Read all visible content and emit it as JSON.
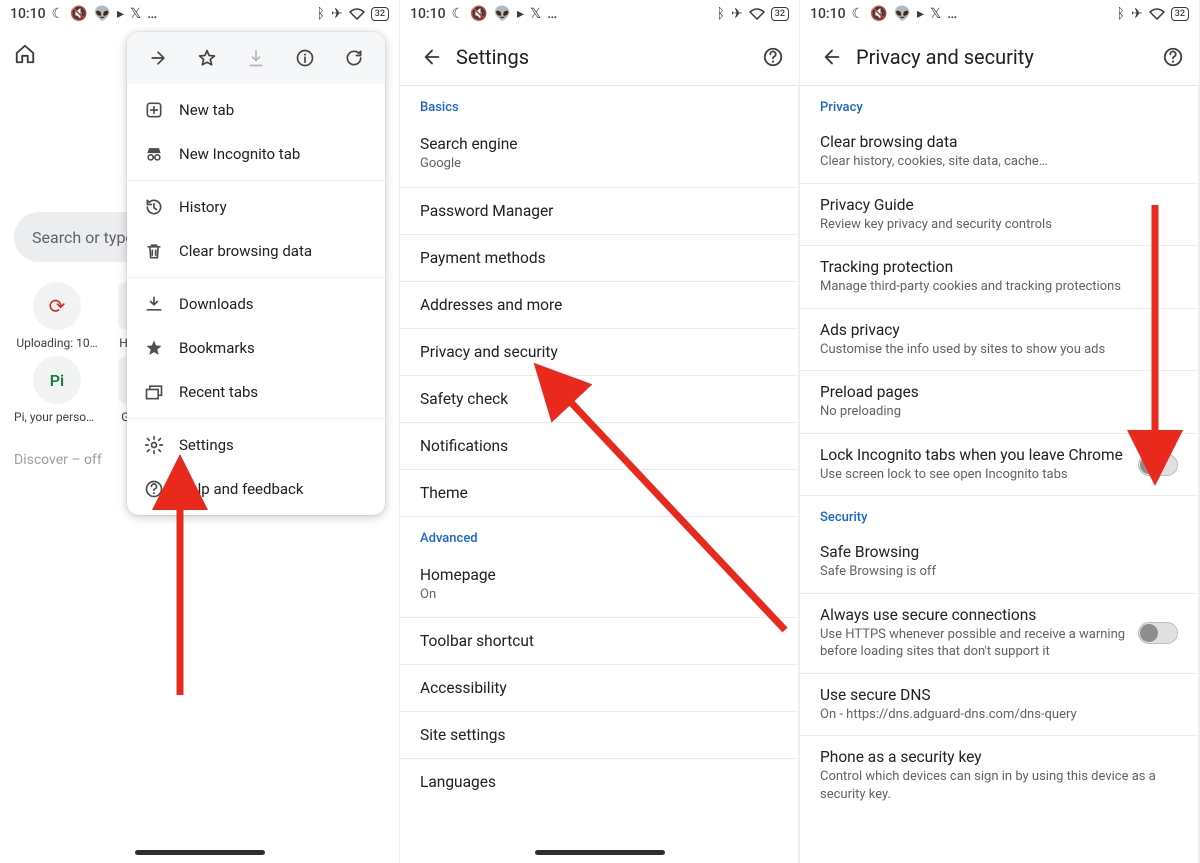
{
  "status": {
    "time": "10:10",
    "battery": "32",
    "left_glyphs": [
      "moon",
      "mute",
      "reddit",
      "play",
      "x",
      "dots"
    ],
    "right_glyphs": [
      "bluetooth",
      "plane",
      "wifi"
    ]
  },
  "panel1": {
    "search_placeholder": "Search or type URL",
    "tiles": [
      {
        "label": "Uploading: 10…",
        "badge": "↻",
        "badge_color": "#d93025"
      },
      {
        "label": "HE…"
      },
      {
        "label": "Pi, your person…",
        "badge": "Pi",
        "badge_color": "#34a853"
      },
      {
        "label": "Gr…"
      }
    ],
    "discover": "Discover – off",
    "menu": {
      "top": [
        "forward",
        "star",
        "download",
        "info",
        "refresh"
      ],
      "items": [
        {
          "icon": "plus-box",
          "label": "New tab"
        },
        {
          "icon": "incognito",
          "label": "New Incognito tab"
        },
        {
          "sep": true
        },
        {
          "icon": "history",
          "label": "History"
        },
        {
          "icon": "trash",
          "label": "Clear browsing data"
        },
        {
          "sep": true
        },
        {
          "icon": "download-tray",
          "label": "Downloads"
        },
        {
          "icon": "star-fill",
          "label": "Bookmarks"
        },
        {
          "icon": "tabs",
          "label": "Recent tabs"
        },
        {
          "sep": true
        },
        {
          "icon": "gear",
          "label": "Settings"
        },
        {
          "icon": "help",
          "label": "Help and feedback"
        }
      ]
    }
  },
  "panel2": {
    "title": "Settings",
    "section_basics": "Basics",
    "section_advanced": "Advanced",
    "rows": {
      "search_engine": {
        "primary": "Search engine",
        "secondary": "Google"
      },
      "password": {
        "primary": "Password Manager"
      },
      "payment": {
        "primary": "Payment methods"
      },
      "addresses": {
        "primary": "Addresses and more"
      },
      "privacy": {
        "primary": "Privacy and security"
      },
      "safety": {
        "primary": "Safety check"
      },
      "notifications": {
        "primary": "Notifications"
      },
      "theme": {
        "primary": "Theme"
      },
      "homepage": {
        "primary": "Homepage",
        "secondary": "On"
      },
      "toolbar": {
        "primary": "Toolbar shortcut"
      },
      "accessibility": {
        "primary": "Accessibility"
      },
      "site": {
        "primary": "Site settings"
      },
      "languages": {
        "primary": "Languages"
      }
    }
  },
  "panel3": {
    "title": "Privacy and security",
    "section_privacy": "Privacy",
    "section_security": "Security",
    "rows": {
      "clear": {
        "primary": "Clear browsing data",
        "secondary": "Clear history, cookies, site data, cache…"
      },
      "guide": {
        "primary": "Privacy Guide",
        "secondary": "Review key privacy and security controls"
      },
      "tracking": {
        "primary": "Tracking protection",
        "secondary": "Manage third-party cookies and tracking protections"
      },
      "ads": {
        "primary": "Ads privacy",
        "secondary": "Customise the info used by sites to show you ads"
      },
      "preload": {
        "primary": "Preload pages",
        "secondary": "No preloading"
      },
      "lock": {
        "primary": "Lock Incognito tabs when you leave Chrome",
        "secondary": "Use screen lock to see open Incognito tabs"
      },
      "safe": {
        "primary": "Safe Browsing",
        "secondary": "Safe Browsing is off"
      },
      "https": {
        "primary": "Always use secure connections",
        "secondary": "Use HTTPS whenever possible and receive a warning before loading sites that don't support it"
      },
      "dns": {
        "primary": "Use secure DNS",
        "secondary": "On - https://dns.adguard-dns.com/dns-query"
      },
      "phonekey": {
        "primary": "Phone as a security key",
        "secondary": "Control which devices can sign in by using this device as a security key."
      }
    }
  }
}
